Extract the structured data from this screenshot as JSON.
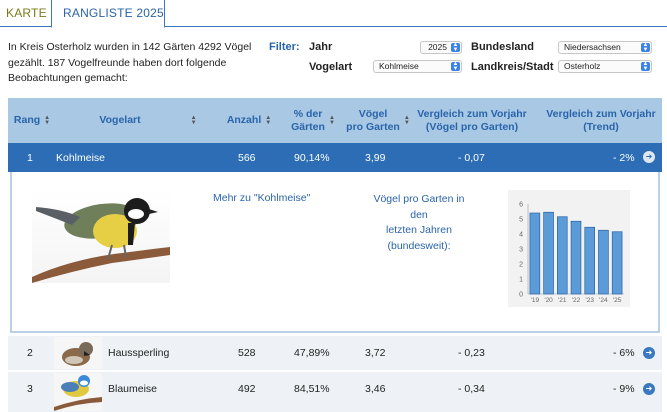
{
  "tabs": [
    {
      "label": "KARTE"
    },
    {
      "label": "RANGLISTE 2025"
    }
  ],
  "intro": {
    "text": "In Kreis Osterholz wurden in 142 Gärten 4292 Vögel gezählt. 187 Vogelfreunde haben dort folgende Beobachtungen gemacht:"
  },
  "filters": {
    "label": "Filter:",
    "jahr": {
      "label": "Jahr",
      "value": "2025"
    },
    "vogelart": {
      "label": "Vogelart",
      "value": "Kohlmeise"
    },
    "bundesland": {
      "label": "Bundesland",
      "value": "Niedersachsen"
    },
    "landkreis": {
      "label": "Landkreis/Stadt",
      "value": "Osterholz"
    }
  },
  "table": {
    "headers": {
      "rang": "Rang",
      "vogelart": "Vogelart",
      "anzahl": "Anzahl",
      "gaerten_1": "% der",
      "gaerten_2": "Gärten",
      "vpg_1": "Vögel",
      "vpg_2": "pro Garten",
      "vgl_1": "Vergleich zum Vorjahr",
      "vgl_2": "(Vögel pro Garten)",
      "trend_1": "Vergleich zum Vorjahr",
      "trend_2": "(Trend)"
    },
    "rows": [
      {
        "rang": "1",
        "name": "Kohlmeise",
        "anzahl": "566",
        "gaerten": "90,14%",
        "vpg": "3,99",
        "vgl": "- 0,07",
        "trend": "- 2%"
      },
      {
        "rang": "2",
        "name": "Haussperling",
        "anzahl": "528",
        "gaerten": "47,89%",
        "vpg": "3,72",
        "vgl": "- 0,23",
        "trend": "- 6%"
      },
      {
        "rang": "3",
        "name": "Blaumeise",
        "anzahl": "492",
        "gaerten": "84,51%",
        "vpg": "3,46",
        "vgl": "- 0,34",
        "trend": "- 9%"
      }
    ]
  },
  "detail": {
    "more_link": "Mehr zu \"Kohlmeise\"",
    "vpg_text_1": "Vögel pro Garten in den",
    "vpg_text_2": "letzten Jahren",
    "vpg_text_3": "(bundesweit):"
  },
  "chart_data": {
    "type": "bar",
    "categories": [
      "'19",
      "'20",
      "'21",
      "'22",
      "'23",
      "'24",
      "'25"
    ],
    "values": [
      5.4,
      5.45,
      5.15,
      4.85,
      4.45,
      4.25,
      4.15
    ],
    "ylim": [
      0,
      6
    ],
    "yticks": [
      "0",
      "1",
      "2",
      "3",
      "4",
      "5",
      "6"
    ],
    "grid": false,
    "colors": {
      "bar": "#5b9bd8",
      "bar_edge": "#2a64aa"
    }
  },
  "icons": {
    "sort": "sort-icon",
    "go": "arrow-right-circle-icon",
    "select": "select-arrows-icon"
  }
}
